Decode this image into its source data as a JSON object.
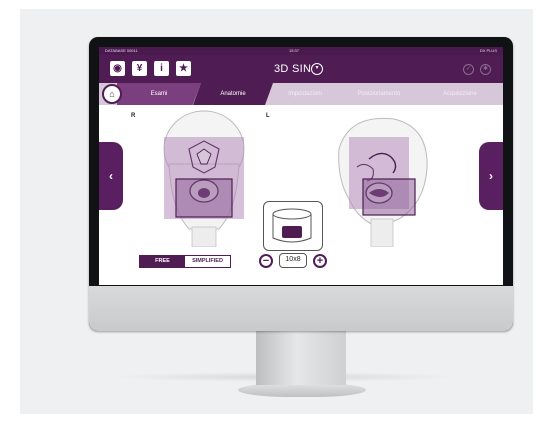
{
  "statusbar": {
    "left": "DATABASE 00011",
    "center": "15:37",
    "right": "DX PLUS"
  },
  "toolbar": {
    "buttons": [
      {
        "icon": "eye-icon",
        "glyph": "◉"
      },
      {
        "icon": "user-icon",
        "glyph": "¥"
      },
      {
        "icon": "info-icon",
        "glyph": "i"
      },
      {
        "icon": "star-icon",
        "glyph": "★"
      }
    ],
    "mode_title": "3D SIN",
    "mode_dropdown_glyph": "▾",
    "right_icons": [
      {
        "icon": "check-icon",
        "glyph": "✓"
      },
      {
        "icon": "gear-icon",
        "glyph": "✱"
      }
    ]
  },
  "tabs": [
    {
      "label": "Esami"
    },
    {
      "label": "Anatomie"
    },
    {
      "label": "Impostazioni"
    },
    {
      "label": "Posizionamento"
    },
    {
      "label": "Acquisizione"
    }
  ],
  "home_glyph": "⌂",
  "view": {
    "left_label": "R",
    "right_label": "L",
    "prev_glyph": "‹",
    "next_glyph": "›"
  },
  "controls": {
    "mode_free": "FREE",
    "mode_simplified": "SIMPLIFIED",
    "size_value": "10x8",
    "minus_glyph": "−",
    "plus_glyph": "+"
  },
  "colors": {
    "brand_dark": "#4f1d54",
    "brand_accent": "#7b3f80",
    "tab_bar": "#d7c8d9",
    "overlay": "#b48cbc"
  }
}
